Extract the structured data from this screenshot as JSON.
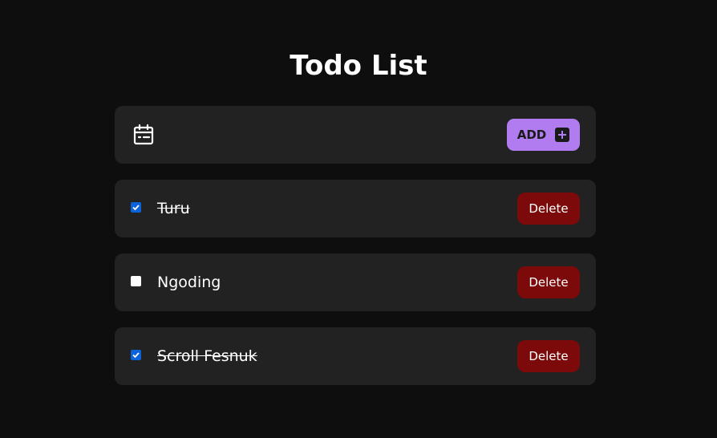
{
  "app": {
    "title": "Todo List"
  },
  "add_bar": {
    "icon": "calendar-icon",
    "add_label": "ADD",
    "add_icon": "plus-square-icon"
  },
  "colors": {
    "background": "#0e0e0e",
    "card": "#222222",
    "add_button": "#b17cf0",
    "delete_button": "#7c0a0a",
    "checkbox_checked": "#0a63d8"
  },
  "todos": [
    {
      "text": "Turu",
      "done": true,
      "delete_label": "Delete"
    },
    {
      "text": "Ngoding",
      "done": false,
      "delete_label": "Delete"
    },
    {
      "text": "Scroll Fesnuk",
      "done": true,
      "delete_label": "Delete"
    }
  ]
}
